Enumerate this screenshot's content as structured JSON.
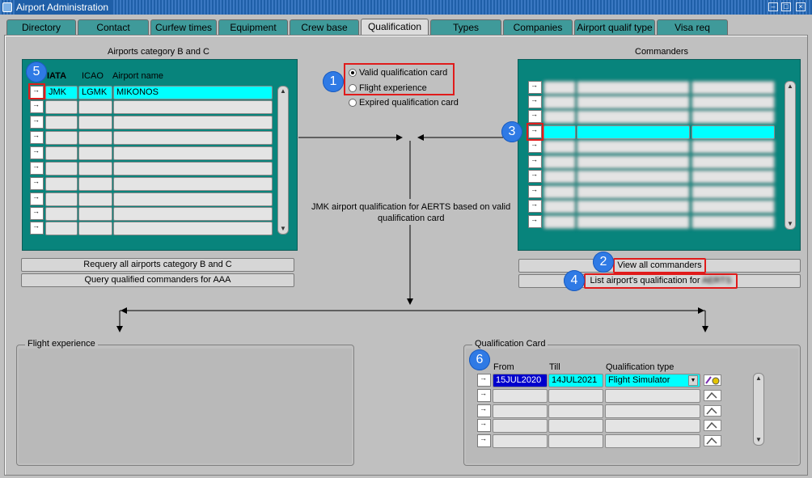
{
  "window": {
    "title": "Airport Administration",
    "controls": [
      "–",
      "□",
      "×"
    ]
  },
  "tabs": [
    {
      "label": "Directory",
      "active": false
    },
    {
      "label": "Contact",
      "active": false
    },
    {
      "label": "Curfew times",
      "active": false
    },
    {
      "label": "Equipment",
      "active": false
    },
    {
      "label": "Crew base",
      "active": false
    },
    {
      "label": "Qualification",
      "active": true
    },
    {
      "label": "Types",
      "active": false
    },
    {
      "label": "Companies",
      "active": false
    },
    {
      "label": "Airport qualif type",
      "active": false
    },
    {
      "label": "Visa req",
      "active": false
    }
  ],
  "airports": {
    "title": "Airports category B and C",
    "columns": [
      "IATA",
      "ICAO",
      "Airport name"
    ],
    "rows": [
      {
        "iata": "JMK",
        "icao": "LGMK",
        "name": "MIKONOS"
      }
    ],
    "requery_button": "Requery all airports category B and C",
    "query_button": "Query qualified commanders for AAA"
  },
  "qualification_options": {
    "items": [
      {
        "label": "Valid qualification card",
        "selected": true
      },
      {
        "label": "Flight experience",
        "selected": false
      },
      {
        "label": "Expired qualification card",
        "selected": false
      }
    ]
  },
  "center_note": {
    "line1": "JMK airport qualification for AERTS based on valid",
    "line2": "qualification card"
  },
  "commanders": {
    "title": "Commanders",
    "view_all_button": "View all commanders",
    "list_button": "List airport's qualification for",
    "list_button_name": "AERTS"
  },
  "flight_experience": {
    "title": "Flight experience"
  },
  "qualification_card": {
    "title": "Qualification Card",
    "columns": [
      "From",
      "Till",
      "Qualification type"
    ],
    "rows": [
      {
        "from": "15JUL2020",
        "till": "14JUL2021",
        "type": "Flight Simulator"
      }
    ]
  },
  "badges": [
    "1",
    "2",
    "3",
    "4",
    "5",
    "6"
  ]
}
